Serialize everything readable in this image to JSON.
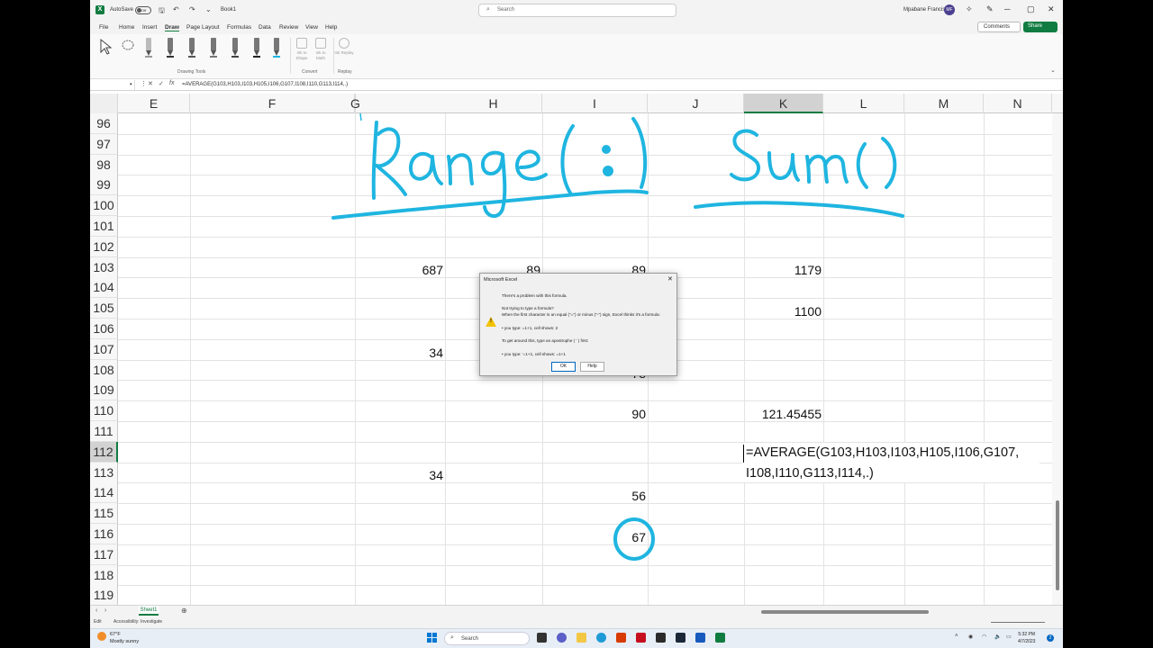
{
  "titlebar": {
    "app_logo": "X",
    "autosave_label": "AutoSave",
    "autosave_state": "Off",
    "book_name": "Book1",
    "search_placeholder": "Search",
    "user_name": "Mpabane Francis",
    "user_initials": "MF"
  },
  "menu": {
    "tabs": [
      "File",
      "Home",
      "Insert",
      "Draw",
      "Page Layout",
      "Formulas",
      "Data",
      "Review",
      "View",
      "Help"
    ],
    "active_tab": "Draw",
    "comments_label": "Comments",
    "share_label": "Share"
  },
  "ribbon": {
    "group_drawing_tools": "Drawing Tools",
    "group_convert": "Convert",
    "group_replay": "Replay",
    "ink_to_shape": "Ink to Shape",
    "ink_to_math": "Ink to Math",
    "ink_replay": "Ink Replay"
  },
  "formula_bar": {
    "fx": "fx",
    "formula": "=AVERAGE(G103,H103,I103,H105,I106,G107,I108,I110,G113,I114,.)"
  },
  "grid": {
    "columns": [
      "E",
      "F",
      "G",
      "H",
      "I",
      "J",
      "K",
      "L",
      "M",
      "N"
    ],
    "selected_column": "K",
    "rows": [
      "96",
      "97",
      "98",
      "99",
      "100",
      "101",
      "102",
      "103",
      "104",
      "105",
      "106",
      "107",
      "108",
      "109",
      "110",
      "111",
      "112",
      "113",
      "114",
      "115",
      "116",
      "117",
      "118",
      "119"
    ],
    "selected_row": "112",
    "values": {
      "g103": "687",
      "h103": "89",
      "i103": "89",
      "k103": "1179",
      "k105": "1100",
      "g107": "34",
      "i108": "78",
      "i110": "90",
      "k110": "121.45455",
      "g113": "34",
      "i114": "56",
      "i116": "67"
    },
    "edit_line1": "=AVERAGE(G103,H103,I103,H105,I106,G107,",
    "edit_line2": "I108,I110,G113,I114,.)"
  },
  "dialog": {
    "title": "Microsoft Excel",
    "line1": "There's a problem with this formula.",
    "line2": "Not trying to type a formula?",
    "line3": "When the first character is an equal (\"=\") or minus (\"-\") sign, Excel thinks it's a formula:",
    "line4": "• you type:   =1+1, cell shows:   2",
    "line5": "To get around this, type an apostrophe ( ' ) first:",
    "line6": "• you type:   '=1+1, cell shows:   =1+1",
    "ok_label": "OK",
    "help_label": "Help"
  },
  "sheet": {
    "tab_name": "Sheet1",
    "status_mode": "Edit",
    "accessibility": "Accessibility: Investigate"
  },
  "taskbar": {
    "temperature": "67°F",
    "weather": "Mostly sunny",
    "search_label": "Search",
    "time": "5:32 PM",
    "date": "4/7/2023",
    "notification_count": "2"
  },
  "colors": {
    "excel_green": "#107c41",
    "ink_blue": "#1fb5e0",
    "warning_yellow": "#f2c200"
  }
}
